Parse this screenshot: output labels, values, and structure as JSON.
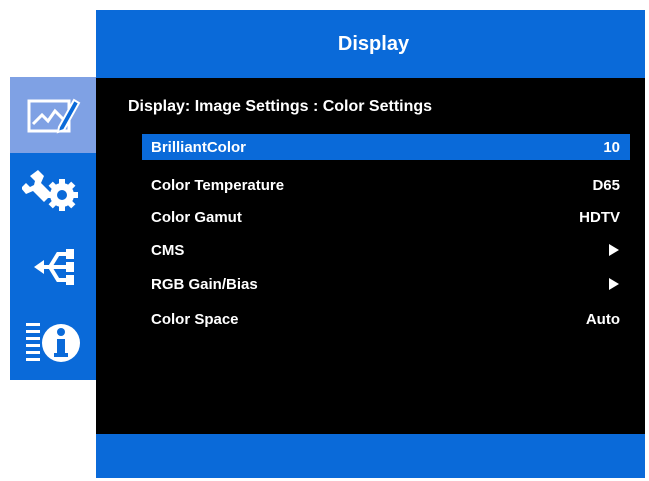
{
  "header": {
    "title": "Display"
  },
  "breadcrumb": "Display: Image Settings : Color Settings",
  "sidebar": {
    "items": [
      {
        "icon": "display-picture-icon",
        "active": true
      },
      {
        "icon": "tools-settings-icon",
        "active": false
      },
      {
        "icon": "connectivity-icon",
        "active": false
      },
      {
        "icon": "information-icon",
        "active": false
      }
    ]
  },
  "menu": {
    "items": [
      {
        "label": "BrilliantColor",
        "value": "10",
        "selected": true
      },
      {
        "label": "Color Temperature",
        "value": "D65"
      },
      {
        "label": "Color Gamut",
        "value": "HDTV"
      },
      {
        "label": "CMS",
        "value": "",
        "submenu": true
      },
      {
        "label": "RGB Gain/Bias",
        "value": "",
        "submenu": true
      },
      {
        "label": "Color Space",
        "value": "Auto"
      }
    ]
  },
  "colors": {
    "accent": "#0a6ad9",
    "active_tab": "#7fa1e4",
    "background": "#000000",
    "text": "#ffffff"
  }
}
